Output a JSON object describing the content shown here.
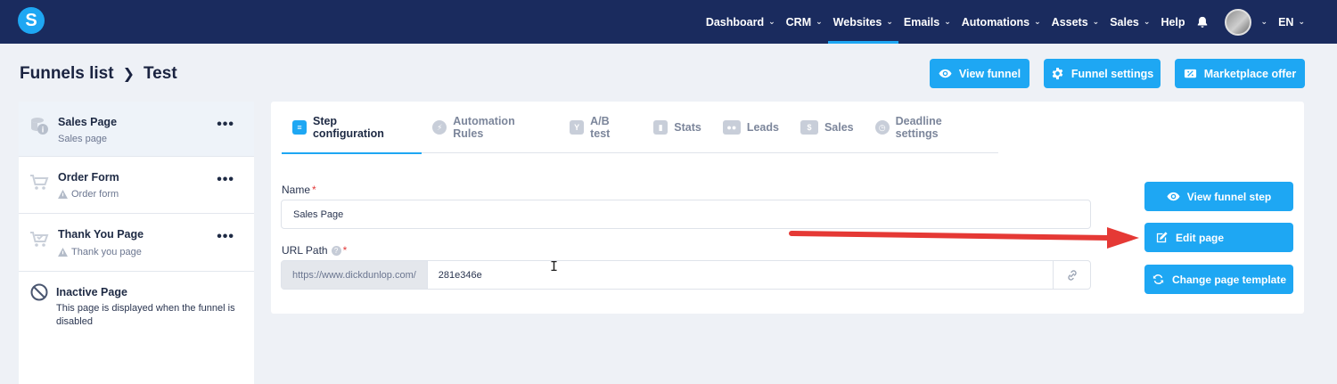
{
  "app": {
    "logo_letter": "S"
  },
  "nav": {
    "items": [
      {
        "label": "Dashboard",
        "chevron": true,
        "active": false
      },
      {
        "label": "CRM",
        "chevron": true,
        "active": false
      },
      {
        "label": "Websites",
        "chevron": true,
        "active": true
      },
      {
        "label": "Emails",
        "chevron": true,
        "active": false
      },
      {
        "label": "Automations",
        "chevron": true,
        "active": false
      },
      {
        "label": "Assets",
        "chevron": true,
        "active": false
      },
      {
        "label": "Sales",
        "chevron": true,
        "active": false
      },
      {
        "label": "Help",
        "chevron": false,
        "active": false
      }
    ],
    "language": "EN"
  },
  "breadcrumb": {
    "parent": "Funnels list",
    "current": "Test"
  },
  "header_buttons": {
    "view_funnel": "View funnel",
    "funnel_settings": "Funnel settings",
    "marketplace_offer": "Marketplace offer"
  },
  "sidebar": {
    "items": [
      {
        "title": "Sales Page",
        "subtitle": "Sales page",
        "icon": "coins-icon"
      },
      {
        "title": "Order Form",
        "subtitle": "Order form",
        "icon": "cart-icon"
      },
      {
        "title": "Thank You Page",
        "subtitle": "Thank you page",
        "icon": "cart-check-icon"
      },
      {
        "title": "Inactive Page",
        "subtitle": "This page is displayed when the funnel is disabled",
        "icon": "ban-icon"
      }
    ],
    "more_label": "•••"
  },
  "tabs": [
    {
      "label": "Step configuration",
      "active": true
    },
    {
      "label": "Automation Rules",
      "active": false
    },
    {
      "label": "A/B test",
      "active": false
    },
    {
      "label": "Stats",
      "active": false
    },
    {
      "label": "Leads",
      "active": false
    },
    {
      "label": "Sales",
      "active": false
    },
    {
      "label": "Deadline settings",
      "active": false
    }
  ],
  "form": {
    "name_label": "Name",
    "name_value": "Sales Page",
    "url_label": "URL Path",
    "url_prefix": "https://www.dickdunlop.com/",
    "url_value": "281e346e",
    "required_mark": "*",
    "info_mark": "?"
  },
  "side_buttons": {
    "view_step": "View funnel step",
    "edit_page": "Edit page",
    "change_template": "Change page template"
  },
  "colors": {
    "nav_bg": "#1a2b5e",
    "accent": "#1ea7f3",
    "arrow": "#e53935"
  }
}
